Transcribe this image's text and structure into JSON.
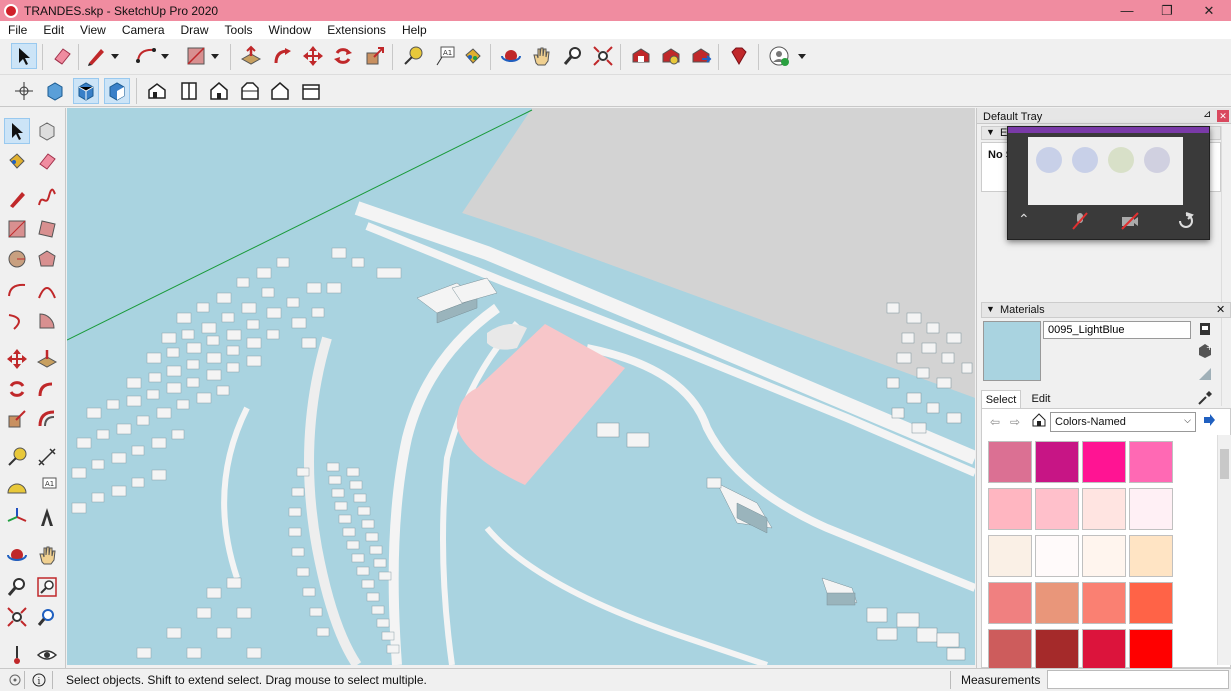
{
  "window": {
    "title": "TRANDES.skp - SketchUp Pro 2020",
    "minimize": "—",
    "maximize": "❐",
    "close": "✕"
  },
  "menu": [
    "File",
    "Edit",
    "View",
    "Camera",
    "Draw",
    "Tools",
    "Window",
    "Extensions",
    "Help"
  ],
  "tray": {
    "title": "Default Tray",
    "pin": "⊿",
    "close": "✕",
    "entity_panel_label": "E",
    "entity_info_text": "No S"
  },
  "materials": {
    "header": "Materials",
    "name_value": "0095_LightBlue",
    "tab_select": "Select",
    "tab_edit": "Edit",
    "library": "Colors-Named",
    "preview_color": "#a9d3e0",
    "swatches": [
      [
        "#db7093",
        "#c71585",
        "#ff1493",
        "#ff69b4"
      ],
      [
        "#ffb6c1",
        "#ffc0cb",
        "#ffe4e1",
        "#fff0f5"
      ],
      [
        "#faf0e6",
        "#fffafa",
        "#fff5ee",
        "#ffe4c4"
      ],
      [
        "#f08080",
        "#e9967a",
        "#fa8072",
        "#ff6347"
      ],
      [
        "#cd5c5c",
        "#a52a2a",
        "#dc143c",
        "#ff0000"
      ]
    ]
  },
  "status": {
    "message": "Select objects. Shift to extend select. Drag mouse to select multiple.",
    "measurements_label": "Measurements",
    "measurements_value": ""
  },
  "colors": {
    "titlebar": "#f08ca0",
    "viewport_ground": "#a9d3e0",
    "sky": "#d3d3d3",
    "building": "#f4f4f4",
    "road": "#f0f0f0",
    "site": "#f7c6c9"
  }
}
